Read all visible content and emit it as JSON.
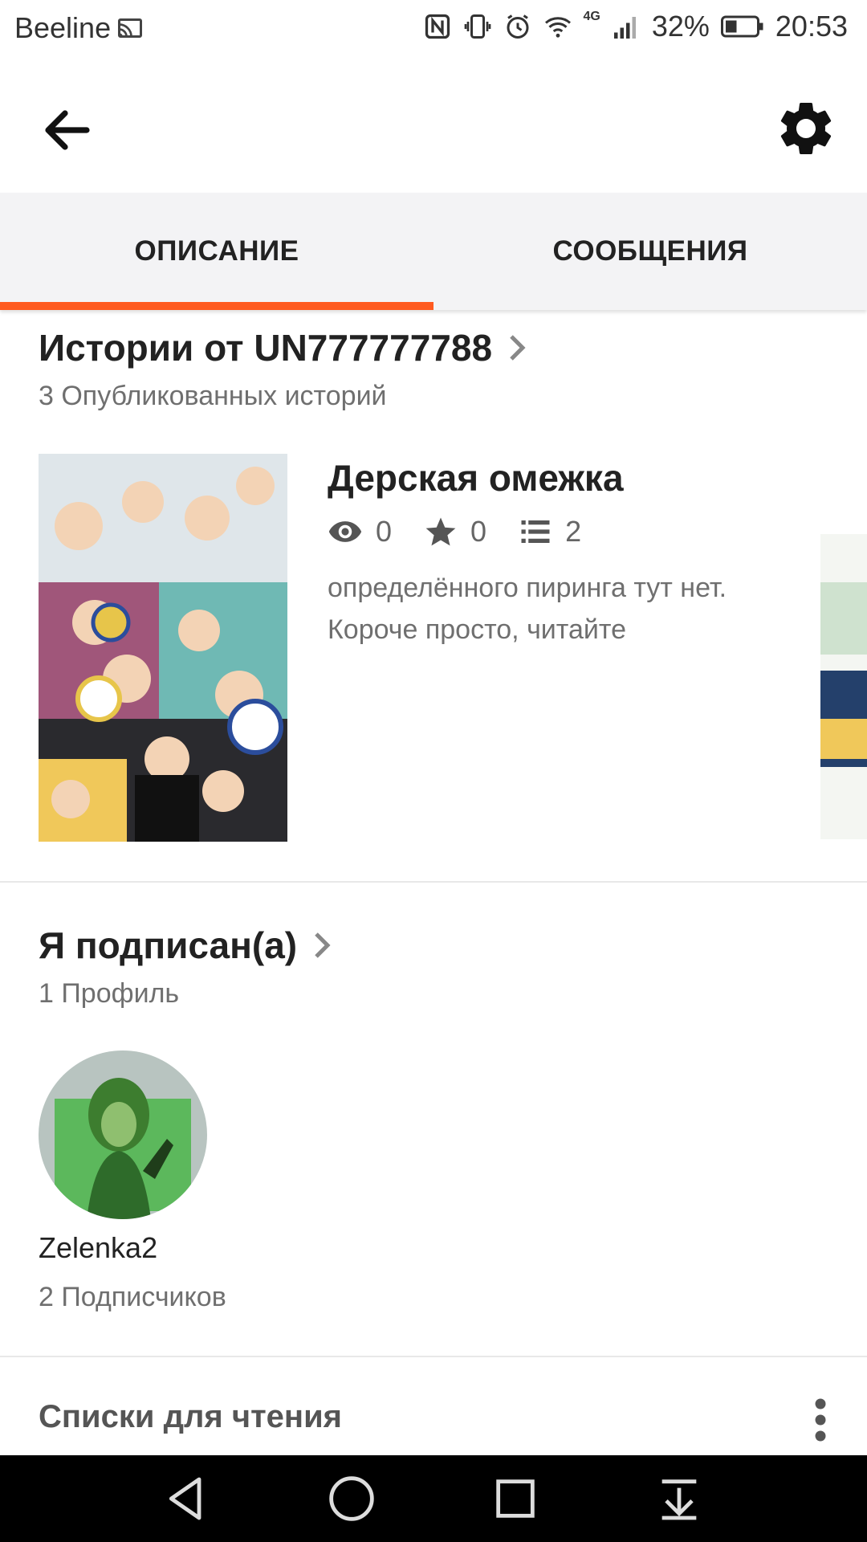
{
  "status_bar": {
    "carrier": "Beeline",
    "network_type": "4G",
    "battery": "32%",
    "time": "20:53"
  },
  "app_bar": {
    "back_icon": "arrow-left-icon",
    "settings_icon": "gear-icon"
  },
  "tabs": [
    {
      "label": "ОПИСАНИЕ",
      "active": true
    },
    {
      "label": "СООБЩЕНИЯ",
      "active": false
    }
  ],
  "stories": {
    "title": "Истории от UN777777788",
    "count_label": "3 Опубликованных историй",
    "items": [
      {
        "title": "Дерская омежка",
        "views": "0",
        "votes": "0",
        "parts": "2",
        "description": "определённого пиринга тут нет. Короче просто, читайте"
      }
    ]
  },
  "following": {
    "title": "Я подписан(а)",
    "count_label": "1 Профиль",
    "profiles": [
      {
        "name": "Zelenka2",
        "followers": "2 Подписчиков"
      }
    ]
  },
  "reading_lists": {
    "title": "Списки для чтения",
    "more_icon": "more-vertical-icon"
  },
  "colors": {
    "accent": "#ff5a1f",
    "tab_background": "#f3f3f5"
  }
}
